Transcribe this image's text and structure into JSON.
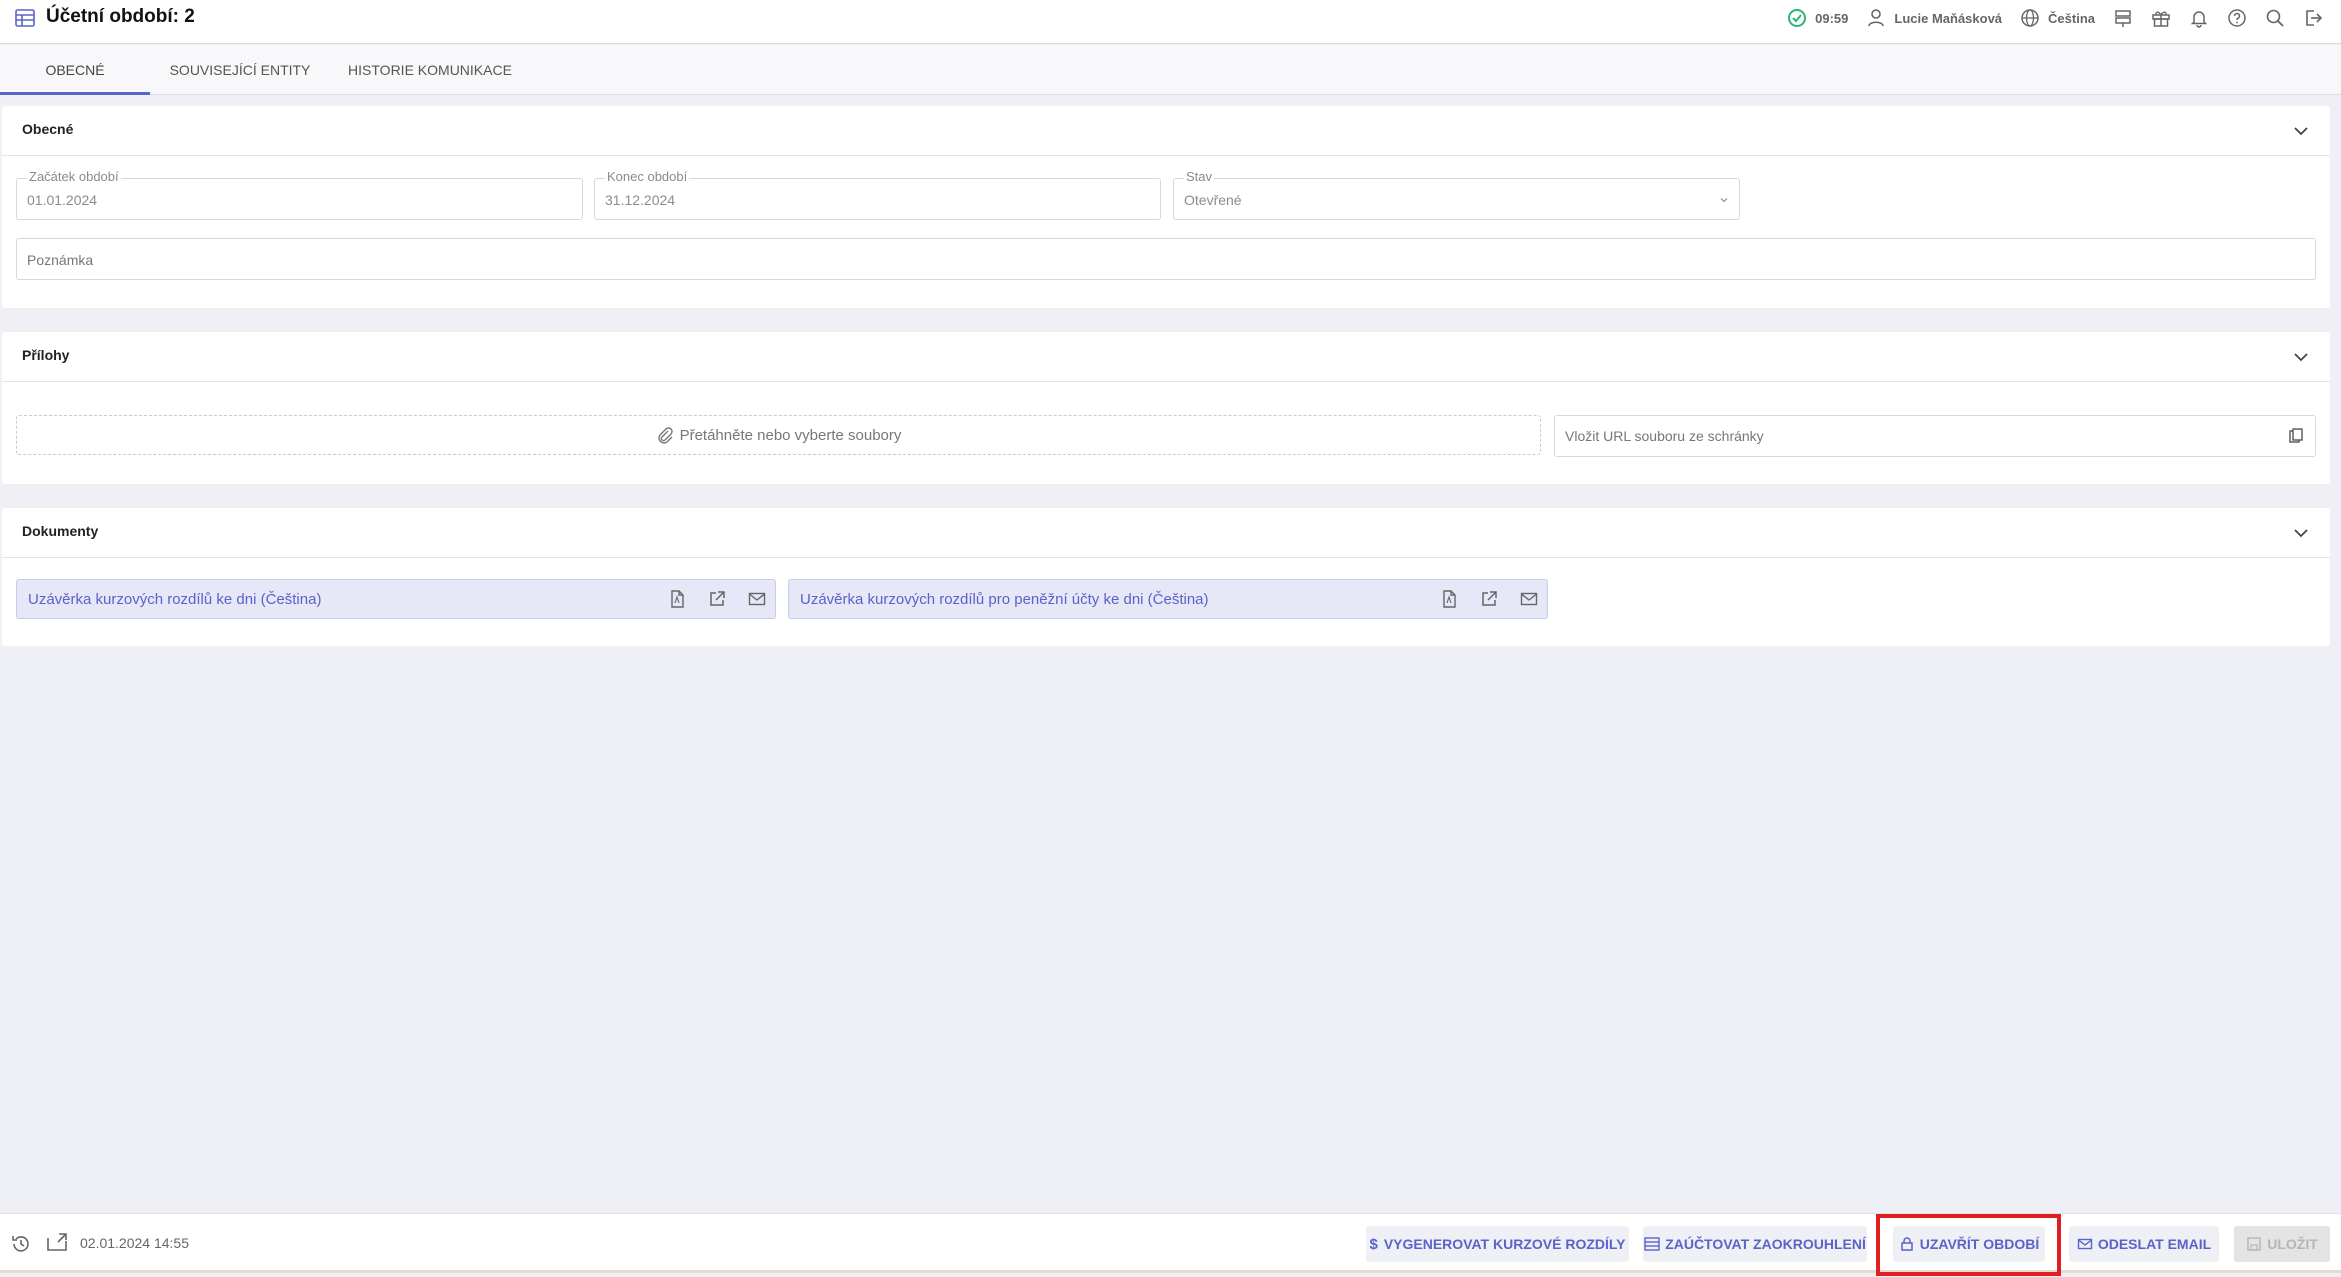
{
  "header": {
    "title": "Účetní období: 2",
    "time": "09:59",
    "user": "Lucie Maňásková",
    "language": "Čeština"
  },
  "tabs": [
    {
      "label": "OBECNÉ"
    },
    {
      "label": "SOUVISEJÍCÍ ENTITY"
    },
    {
      "label": "HISTORIE KOMUNIKACE"
    }
  ],
  "general": {
    "title": "Obecné",
    "start_label": "Začátek období",
    "start_value": "01.01.2024",
    "end_label": "Konec období",
    "end_value": "31.12.2024",
    "state_label": "Stav",
    "state_value": "Otevřené",
    "note_placeholder": "Poznámka"
  },
  "attachments": {
    "title": "Přílohy",
    "drop_text": "Přetáhněte nebo vyberte soubory",
    "url_placeholder": "Vložit URL souboru ze schránky"
  },
  "documents": {
    "title": "Dokumenty",
    "items": [
      {
        "label": "Uzávěrka kurzových rozdílů ke dni (Čeština)"
      },
      {
        "label": "Uzávěrka kurzových rozdílů pro peněžní účty ke dni (Čeština)"
      }
    ]
  },
  "footer": {
    "timestamp": "02.01.2024 14:55",
    "buttons": {
      "generate": "VYGENEROVAT KURZOVÉ ROZDÍLY",
      "post_rounding": "ZAÚČTOVAT ZAOKROUHLENÍ",
      "close_period": "UZAVŘÍT OBDOBÍ",
      "send_email": "ODESLAT EMAIL",
      "save": "ULOŽIT"
    }
  },
  "colors": {
    "accent": "#5a63c8",
    "highlight": "#e02020",
    "status_ok": "#2bb673"
  }
}
